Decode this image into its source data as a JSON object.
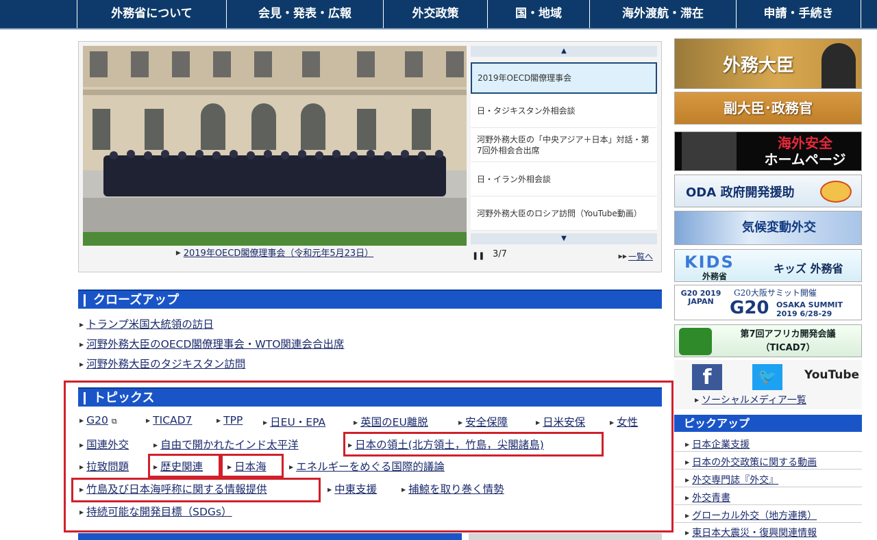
{
  "nav": [
    "外務省について",
    "会見・発表・広報",
    "外交政策",
    "国・地域",
    "海外渡航・滞在",
    "申請・手続き"
  ],
  "slider": {
    "caption": "2019年OECD閣僚理事会（令和元年5月23日）",
    "items": [
      "2019年OECD閣僚理事会",
      "日・タジキスタン外相会談",
      "河野外務大臣の「中央アジア＋日本」対話・第7回外相会合出席",
      "日・イラン外相会談",
      "河野外務大臣のロシア訪問（YouTube動画）"
    ],
    "counter": "3/7",
    "all_link": "一覧へ"
  },
  "closeup": {
    "title": "クローズアップ",
    "links": [
      "トランプ米国大統領の訪日",
      "河野外務大臣のOECD閣僚理事会・WTO関連会合出席",
      "河野外務大臣のタジキスタン訪問"
    ]
  },
  "topics": {
    "title": "トピックス",
    "row1": [
      "G20",
      "TICAD7",
      "TPP",
      "日EU・EPA",
      "英国のEU離脱",
      "安全保障",
      "日米安保",
      "女性"
    ],
    "row2": [
      "国連外交",
      "自由で開かれたインド太平洋",
      "日本の領土(北方領土，竹島，尖閣諸島)"
    ],
    "row3": [
      "拉致問題",
      "歴史関連",
      "日本海",
      "エネルギーをめぐる国際的議論"
    ],
    "row4": [
      "竹島及び日本海呼称に関する情報提供",
      "中東支援",
      "捕鯨を取り巻く情勢"
    ],
    "row5": [
      "持続可能な開発目標（SDGs）"
    ]
  },
  "side": {
    "minister": "外務大臣",
    "vice": "副大臣･政務官",
    "safety_1": "海外安全",
    "safety_2": "ホームページ",
    "oda": "ODA 政府開発援助",
    "climate": "気候変動外交",
    "kids": "キッズ 外務省",
    "kids_logo": "KIDS",
    "kids_sub": "外務省",
    "g20_top": "G20大阪サミット開催",
    "g20_main": "G20",
    "g20_osaka": "OSAKA SUMMIT",
    "g20_date": "2019 6/28-29",
    "g20_logo": "G20 2019 JAPAN",
    "ticad_1": "第7回アフリカ開発会議",
    "ticad_2": "（TICAD7）",
    "social_link": "ソーシャルメディア一覧",
    "youtube": "YouTube",
    "pickup_title": "ピックアップ",
    "pickup": [
      "日本企業支援",
      "日本の外交政策に関する動画",
      "外交専門誌『外交』",
      "外交青書",
      "グローカル外交（地方連携）",
      "東日本大震災・復興関連情報"
    ]
  },
  "colors": {
    "nav_bg": "#0d3a6a",
    "header_blue": "#1a55c8",
    "highlight_red": "#d0202b",
    "banner_gold": "#d8a040"
  }
}
